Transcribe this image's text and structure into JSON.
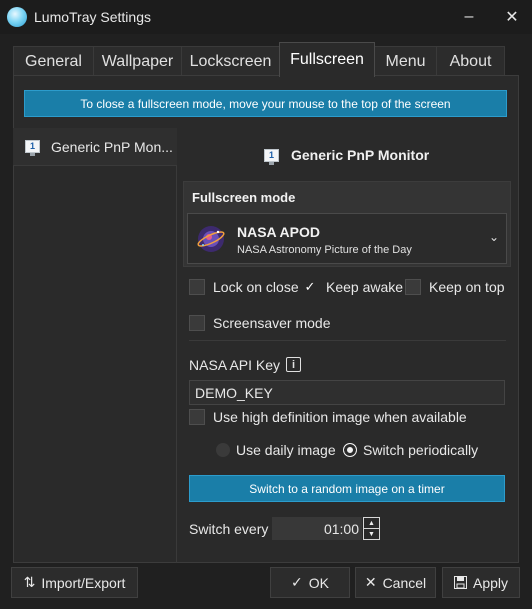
{
  "window": {
    "title": "LumoTray Settings",
    "minimize_glyph": "–",
    "close_glyph": "✕"
  },
  "tabs": [
    {
      "label": "General"
    },
    {
      "label": "Wallpaper"
    },
    {
      "label": "Lockscreen"
    },
    {
      "label": "Fullscreen",
      "active": true
    },
    {
      "label": "Menu"
    },
    {
      "label": "About"
    }
  ],
  "banner": {
    "text": "To close a fullscreen mode, move your mouse to the top of the screen"
  },
  "monitor_list": {
    "items": [
      {
        "label": "Generic PnP Mon..."
      }
    ]
  },
  "monitor": {
    "title": "Generic PnP Monitor",
    "icon_number": "1"
  },
  "fullscreen_mode": {
    "label": "Fullscreen mode",
    "selected_name": "NASA APOD",
    "selected_desc": "NASA Astronomy Picture of the Day",
    "chevron": "⌄"
  },
  "options": {
    "lock_on_close": {
      "label": "Lock on close",
      "checked": false
    },
    "keep_awake": {
      "label": "Keep awake",
      "checked": true
    },
    "keep_on_top": {
      "label": "Keep on top",
      "checked": false
    },
    "screensaver_mode": {
      "label": "Screensaver mode",
      "checked": false
    }
  },
  "api_key": {
    "label": "NASA API Key",
    "info_glyph": "i",
    "value": "DEMO_KEY"
  },
  "high_def": {
    "label": "Use high definition image when available",
    "checked": false
  },
  "image_mode": {
    "daily": {
      "label": "Use daily image",
      "selected": false
    },
    "periodic": {
      "label": "Switch periodically",
      "selected": true
    }
  },
  "random_button": {
    "label": "Switch to a random image on a timer"
  },
  "switch_every": {
    "label": "Switch every",
    "value": "01:00"
  },
  "footer": {
    "import_export": "Import/Export",
    "ok": "OK",
    "cancel": "Cancel",
    "apply": "Apply"
  },
  "colors": {
    "accent": "#1a7ea8",
    "background": "#202020",
    "panel": "#2a2a2a"
  }
}
